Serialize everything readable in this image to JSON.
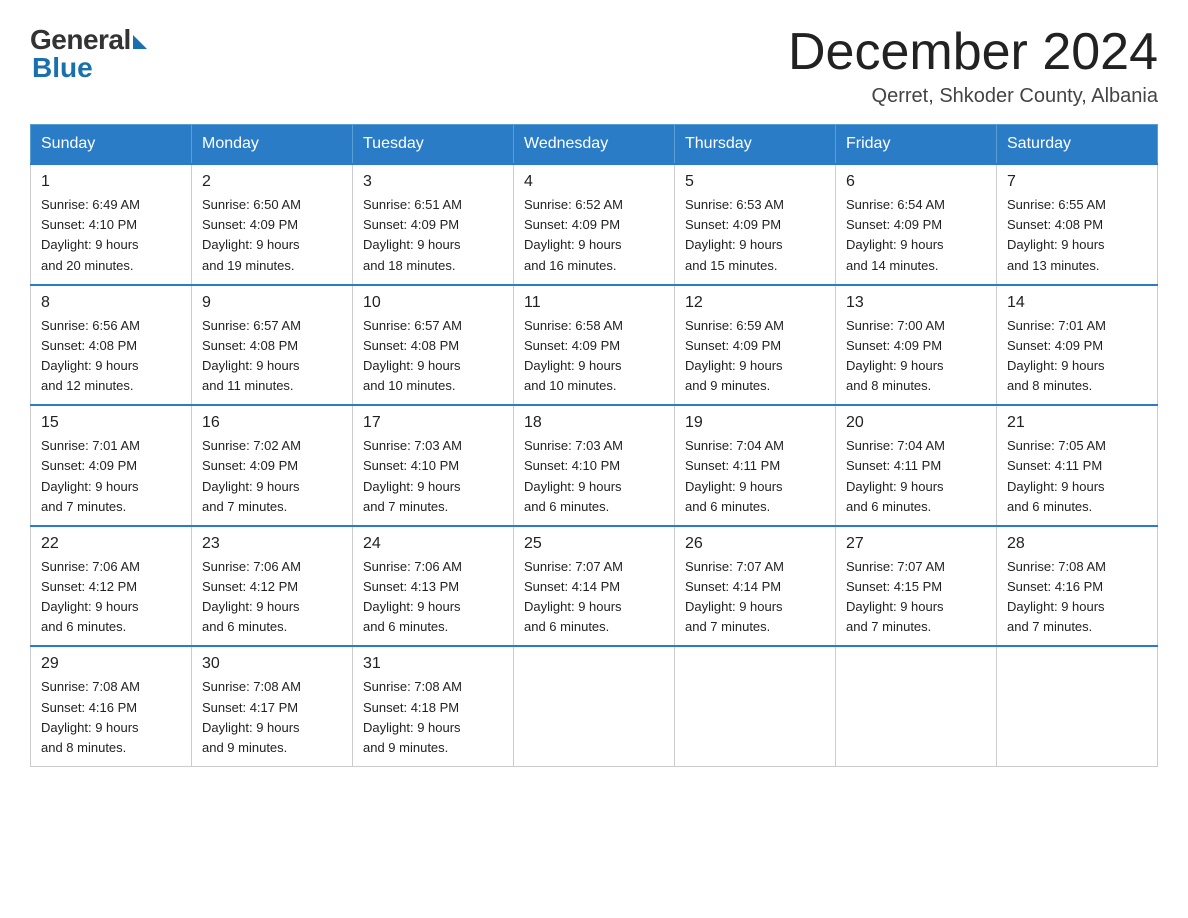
{
  "header": {
    "logo_general": "General",
    "logo_blue": "Blue",
    "title": "December 2024",
    "location": "Qerret, Shkoder County, Albania"
  },
  "days_of_week": [
    "Sunday",
    "Monday",
    "Tuesday",
    "Wednesday",
    "Thursday",
    "Friday",
    "Saturday"
  ],
  "weeks": [
    [
      {
        "day": "1",
        "sunrise": "6:49 AM",
        "sunset": "4:10 PM",
        "daylight": "9 hours and 20 minutes."
      },
      {
        "day": "2",
        "sunrise": "6:50 AM",
        "sunset": "4:09 PM",
        "daylight": "9 hours and 19 minutes."
      },
      {
        "day": "3",
        "sunrise": "6:51 AM",
        "sunset": "4:09 PM",
        "daylight": "9 hours and 18 minutes."
      },
      {
        "day": "4",
        "sunrise": "6:52 AM",
        "sunset": "4:09 PM",
        "daylight": "9 hours and 16 minutes."
      },
      {
        "day": "5",
        "sunrise": "6:53 AM",
        "sunset": "4:09 PM",
        "daylight": "9 hours and 15 minutes."
      },
      {
        "day": "6",
        "sunrise": "6:54 AM",
        "sunset": "4:09 PM",
        "daylight": "9 hours and 14 minutes."
      },
      {
        "day": "7",
        "sunrise": "6:55 AM",
        "sunset": "4:08 PM",
        "daylight": "9 hours and 13 minutes."
      }
    ],
    [
      {
        "day": "8",
        "sunrise": "6:56 AM",
        "sunset": "4:08 PM",
        "daylight": "9 hours and 12 minutes."
      },
      {
        "day": "9",
        "sunrise": "6:57 AM",
        "sunset": "4:08 PM",
        "daylight": "9 hours and 11 minutes."
      },
      {
        "day": "10",
        "sunrise": "6:57 AM",
        "sunset": "4:08 PM",
        "daylight": "9 hours and 10 minutes."
      },
      {
        "day": "11",
        "sunrise": "6:58 AM",
        "sunset": "4:09 PM",
        "daylight": "9 hours and 10 minutes."
      },
      {
        "day": "12",
        "sunrise": "6:59 AM",
        "sunset": "4:09 PM",
        "daylight": "9 hours and 9 minutes."
      },
      {
        "day": "13",
        "sunrise": "7:00 AM",
        "sunset": "4:09 PM",
        "daylight": "9 hours and 8 minutes."
      },
      {
        "day": "14",
        "sunrise": "7:01 AM",
        "sunset": "4:09 PM",
        "daylight": "9 hours and 8 minutes."
      }
    ],
    [
      {
        "day": "15",
        "sunrise": "7:01 AM",
        "sunset": "4:09 PM",
        "daylight": "9 hours and 7 minutes."
      },
      {
        "day": "16",
        "sunrise": "7:02 AM",
        "sunset": "4:09 PM",
        "daylight": "9 hours and 7 minutes."
      },
      {
        "day": "17",
        "sunrise": "7:03 AM",
        "sunset": "4:10 PM",
        "daylight": "9 hours and 7 minutes."
      },
      {
        "day": "18",
        "sunrise": "7:03 AM",
        "sunset": "4:10 PM",
        "daylight": "9 hours and 6 minutes."
      },
      {
        "day": "19",
        "sunrise": "7:04 AM",
        "sunset": "4:11 PM",
        "daylight": "9 hours and 6 minutes."
      },
      {
        "day": "20",
        "sunrise": "7:04 AM",
        "sunset": "4:11 PM",
        "daylight": "9 hours and 6 minutes."
      },
      {
        "day": "21",
        "sunrise": "7:05 AM",
        "sunset": "4:11 PM",
        "daylight": "9 hours and 6 minutes."
      }
    ],
    [
      {
        "day": "22",
        "sunrise": "7:06 AM",
        "sunset": "4:12 PM",
        "daylight": "9 hours and 6 minutes."
      },
      {
        "day": "23",
        "sunrise": "7:06 AM",
        "sunset": "4:12 PM",
        "daylight": "9 hours and 6 minutes."
      },
      {
        "day": "24",
        "sunrise": "7:06 AM",
        "sunset": "4:13 PM",
        "daylight": "9 hours and 6 minutes."
      },
      {
        "day": "25",
        "sunrise": "7:07 AM",
        "sunset": "4:14 PM",
        "daylight": "9 hours and 6 minutes."
      },
      {
        "day": "26",
        "sunrise": "7:07 AM",
        "sunset": "4:14 PM",
        "daylight": "9 hours and 7 minutes."
      },
      {
        "day": "27",
        "sunrise": "7:07 AM",
        "sunset": "4:15 PM",
        "daylight": "9 hours and 7 minutes."
      },
      {
        "day": "28",
        "sunrise": "7:08 AM",
        "sunset": "4:16 PM",
        "daylight": "9 hours and 7 minutes."
      }
    ],
    [
      {
        "day": "29",
        "sunrise": "7:08 AM",
        "sunset": "4:16 PM",
        "daylight": "9 hours and 8 minutes."
      },
      {
        "day": "30",
        "sunrise": "7:08 AM",
        "sunset": "4:17 PM",
        "daylight": "9 hours and 9 minutes."
      },
      {
        "day": "31",
        "sunrise": "7:08 AM",
        "sunset": "4:18 PM",
        "daylight": "9 hours and 9 minutes."
      },
      null,
      null,
      null,
      null
    ]
  ],
  "labels": {
    "sunrise": "Sunrise:",
    "sunset": "Sunset:",
    "daylight": "Daylight:"
  }
}
